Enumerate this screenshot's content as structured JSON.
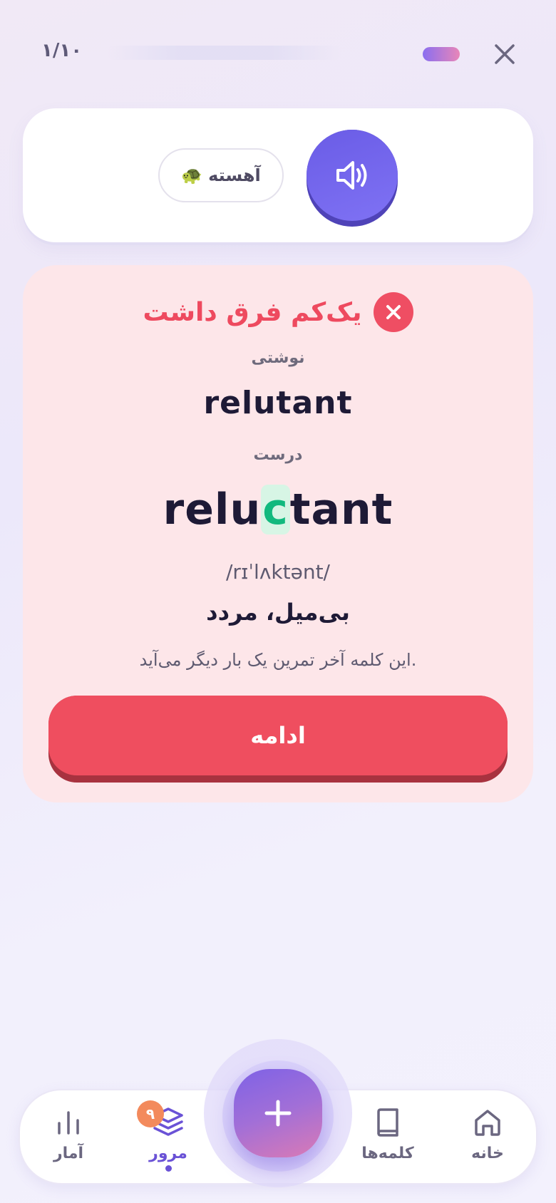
{
  "header": {
    "counter": "۱/۱۰",
    "progress": 0.1,
    "close_icon": "close-icon"
  },
  "audio": {
    "slow_label": "آهسته",
    "slow_emoji": "🐢",
    "speaker_icon": "speaker-icon"
  },
  "feedback": {
    "title": "یک‌کم فرق داشت",
    "typed_label": "نوشتی",
    "typed_word": "relutant",
    "correct_label": "درست",
    "correct_prefix": "relu",
    "correct_highlight": "c",
    "correct_suffix": "tant",
    "phonetic": "/rɪˈlʌktənt/",
    "meaning": "بی‌میل، مردد",
    "note": "این کلمه آخر تمرین یک بار دیگر می‌آید.",
    "continue_label": "ادامه",
    "colors": {
      "error": "#ef4e5f",
      "card_bg": "#fde6e9",
      "highlight": "#12b97e"
    }
  },
  "nav": {
    "items": [
      {
        "label": "خانه",
        "icon": "home-icon"
      },
      {
        "label": "کلمه‌ها",
        "icon": "book-icon"
      },
      {
        "label": "مرور",
        "icon": "layers-icon",
        "active": true,
        "badge": "۹"
      },
      {
        "label": "آمار",
        "icon": "stats-icon"
      }
    ],
    "fab_icon": "plus-icon",
    "accent": "#6a52d6"
  }
}
